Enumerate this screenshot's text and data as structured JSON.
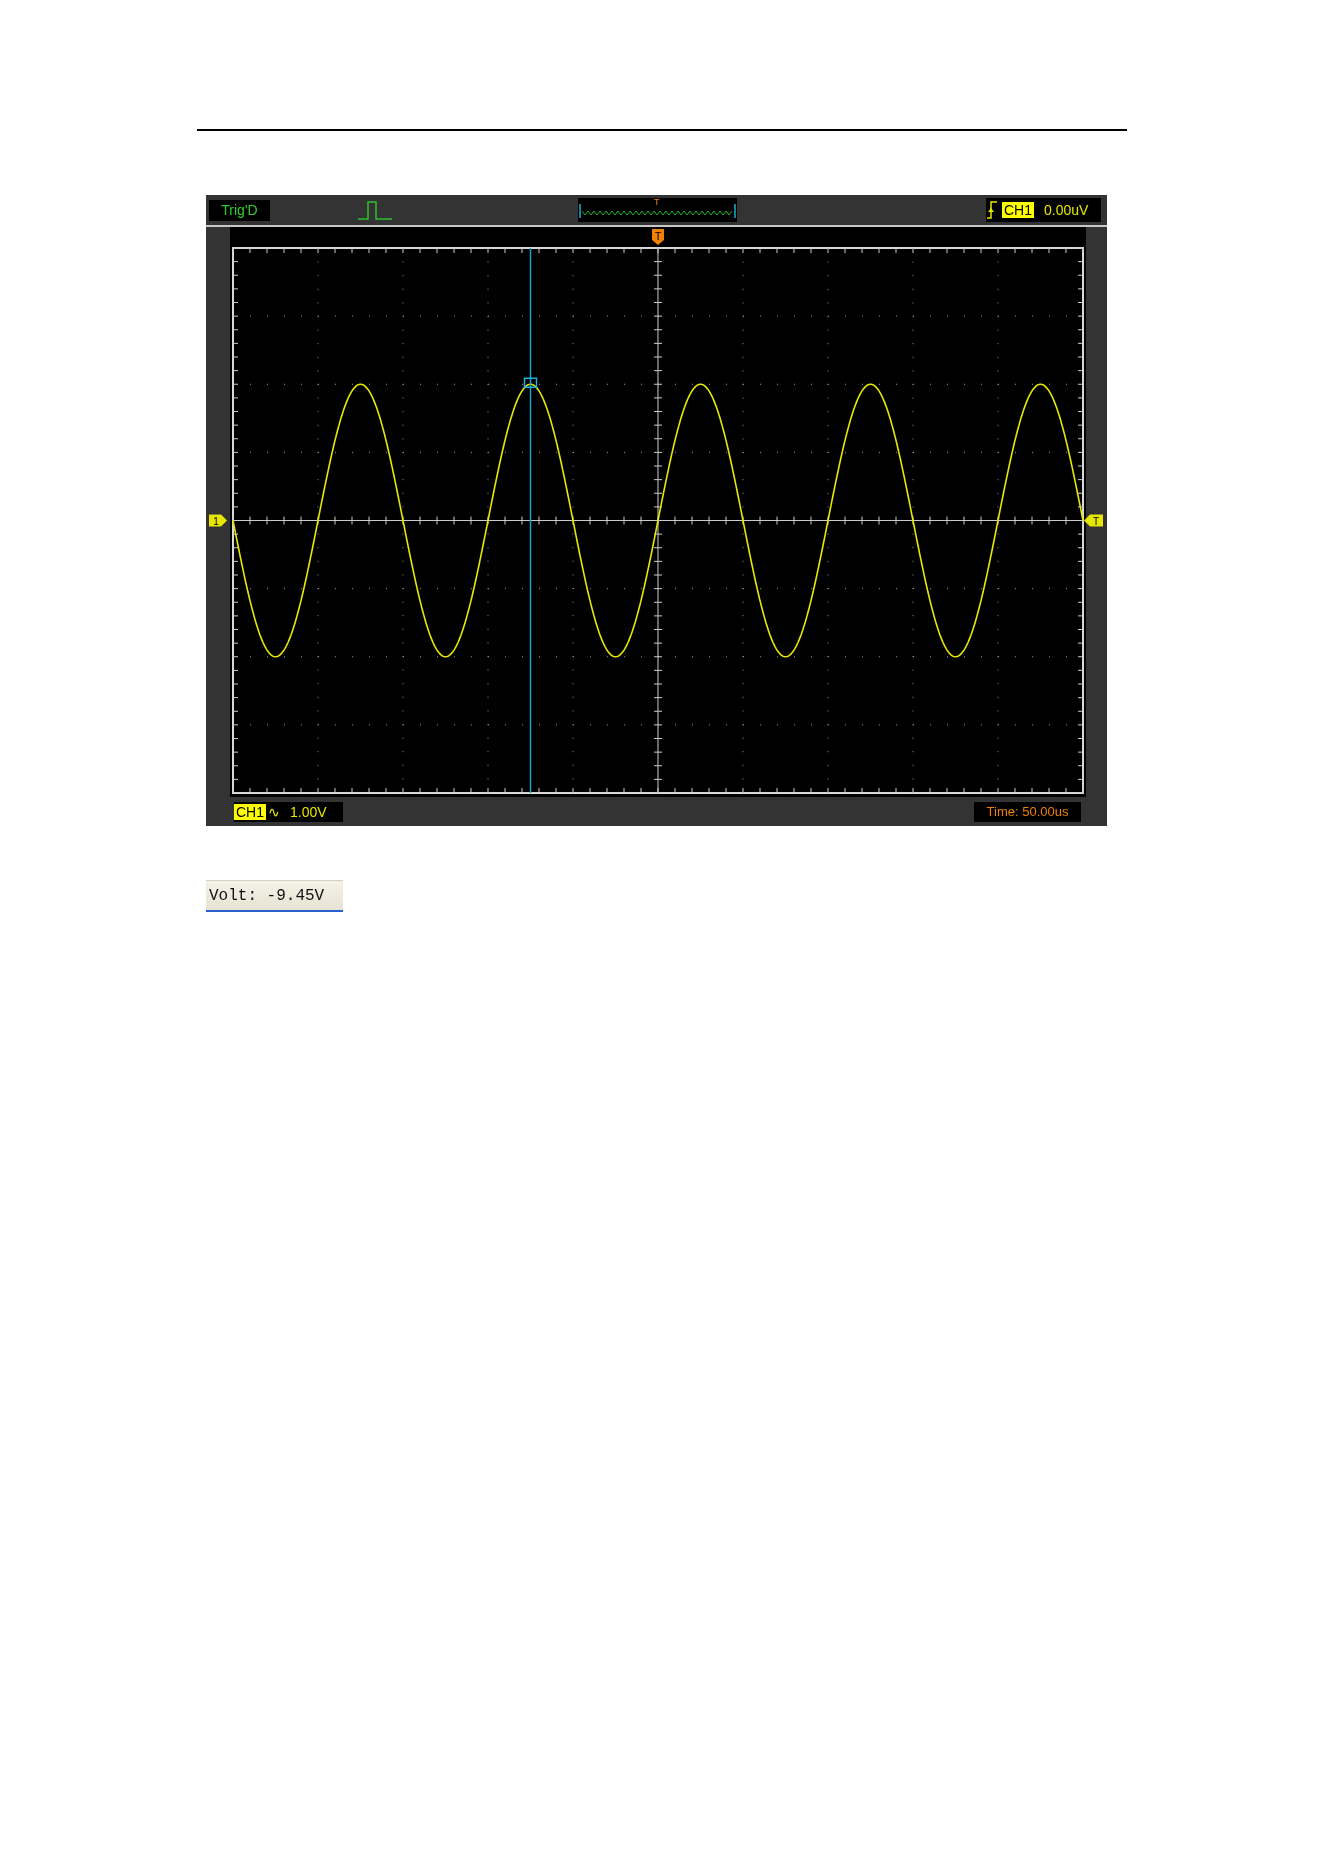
{
  "header": {
    "trigger_status": "Trig'D",
    "position_marker": "T",
    "trigger_source": "CH1",
    "trigger_level": "0.00uV"
  },
  "display": {
    "top_marker": "T",
    "channel_marker": "1",
    "trigger_marker": "T"
  },
  "footer": {
    "channel": "CH1",
    "coupling": "∿",
    "scale": "1.00V",
    "timebase": "Time: 50.00us"
  },
  "readout": "Volt: -9.45V"
}
